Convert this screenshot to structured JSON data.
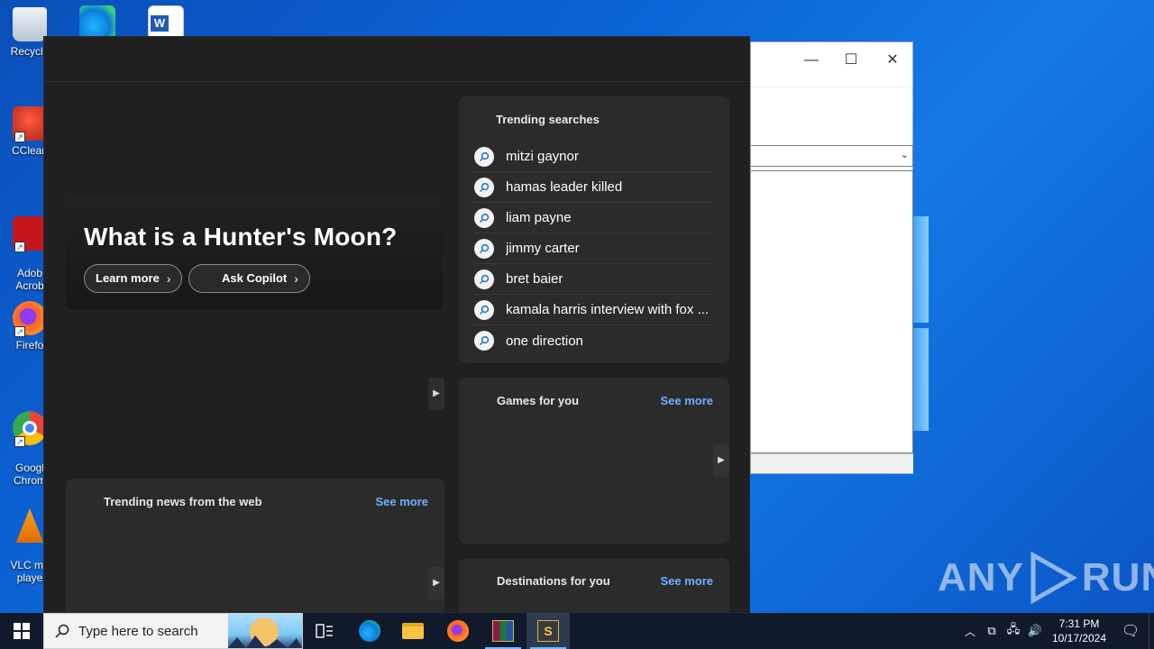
{
  "desktop": {
    "icons": [
      {
        "label": "Recycle",
        "color": "#cfd8e3"
      },
      {
        "label": "CClean",
        "color": "#d9382c"
      },
      {
        "label": "Adob\nAcrob",
        "color": "#c4161c"
      },
      {
        "label": "Firefo",
        "color": "#ff7a1a"
      },
      {
        "label": "Googl\nChrom",
        "color": "#34a853"
      },
      {
        "label": "VLC me\nplaye",
        "color": "#f08a00"
      }
    ]
  },
  "search_panel": {
    "hero": {
      "title": "What is a Hunter's Moon?",
      "learn_more": "Learn more",
      "ask_copilot": "Ask Copilot"
    },
    "trending_searches": {
      "title": "Trending searches",
      "items": [
        "mitzi gaynor",
        "hamas leader killed",
        "liam payne",
        "jimmy carter",
        "bret baier",
        "kamala harris interview with fox ...",
        "one direction"
      ]
    },
    "trending_news": {
      "title": "Trending news from the web",
      "see_more": "See more"
    },
    "games": {
      "title": "Games for you",
      "see_more": "See more"
    },
    "destinations": {
      "title": "Destinations for you",
      "see_more": "See more"
    }
  },
  "taskbar": {
    "search_placeholder": "Type here to search",
    "time": "7:31 PM",
    "date": "10/17/2024"
  },
  "watermark": {
    "text_left": "ANY",
    "text_right": "RUN"
  },
  "colors": {
    "accent_link": "#6fb1ff",
    "panel_bg": "#202020",
    "card_bg": "#2b2b2b"
  }
}
